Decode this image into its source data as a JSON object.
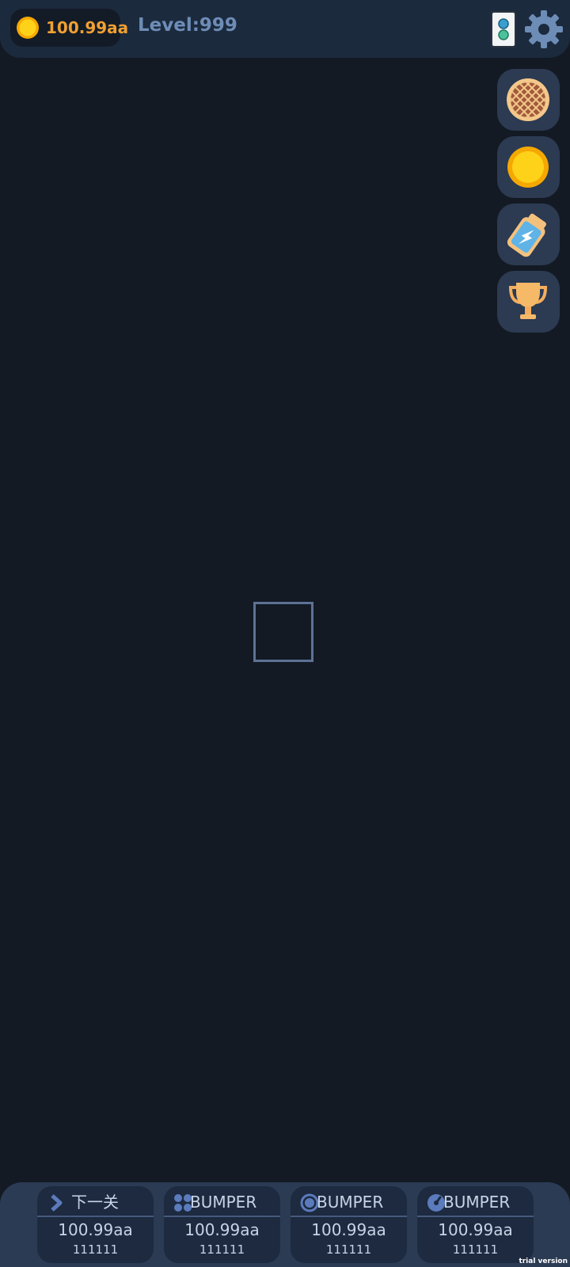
{
  "header": {
    "coins": "100.99aa",
    "level": "Level:999"
  },
  "side_buttons": [
    {
      "name": "pie"
    },
    {
      "name": "coin"
    },
    {
      "name": "energy-battery"
    },
    {
      "name": "trophy"
    }
  ],
  "bottom_cards": [
    {
      "label": "下一关",
      "value": "100.99aa",
      "count": "111111",
      "icon": "chevron-right-icon"
    },
    {
      "label": "BUMPER",
      "value": "100.99aa",
      "count": "111111",
      "icon": "four-dots-icon"
    },
    {
      "label": "BUMPER",
      "value": "100.99aa",
      "count": "111111",
      "icon": "ring-icon"
    },
    {
      "label": "BUMPER",
      "value": "100.99aa",
      "count": "111111",
      "icon": "gauge-icon"
    }
  ],
  "watermark": "trial version",
  "colors": {
    "background": "#131a24",
    "panel": "#1c2a3e",
    "coin_text": "#f0a032",
    "level_text": "#6d8db6",
    "card": "#1d2a3f",
    "accent_icon": "#5b7bbd"
  }
}
